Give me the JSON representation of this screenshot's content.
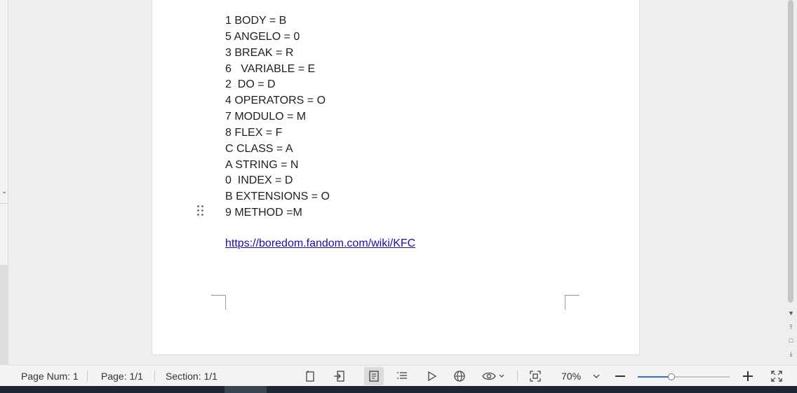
{
  "document": {
    "lines": [
      "1 BODY = B",
      "5 ANGELO = 0",
      "3 BREAK = R",
      "6   VARIABLE = E",
      "2  DO = D",
      "4 OPERATORS = O",
      "7 MODULO = M",
      "8 FLEX = F",
      "C CLASS = A",
      "A STRING = N",
      "0  INDEX = D",
      "B EXTENSIONS = O",
      "9 METHOD =M"
    ],
    "link": "https://boredom.fandom.com/wiki/KFC"
  },
  "statusbar": {
    "page_num": "Page Num: 1",
    "page": "Page: 1/1",
    "section": "Section: 1/1",
    "zoom_value": "70%",
    "zoom_level": 0.36
  },
  "icons": {
    "page_view": "page-view-icon",
    "outline_export": "export-icon",
    "web_layout": "web-layout-icon",
    "outline": "outline-icon",
    "play": "play-icon",
    "globe": "globe-icon",
    "eye": "eye-icon",
    "fit_page": "fit-page-icon",
    "zoom_out": "minus-icon",
    "zoom_in": "plus-icon",
    "fullscreen": "fullscreen-icon"
  },
  "colors": {
    "accent": "#2f6fd6",
    "link": "#1a0dab"
  }
}
